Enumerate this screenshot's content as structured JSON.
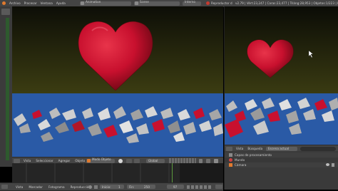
{
  "header": {
    "menu": [
      "Archivo",
      "Procesar",
      "Ventana",
      "Ayuda"
    ],
    "screen_layout": "Animation",
    "scene": "Scene",
    "engine": "Interno",
    "status_left": "Reproductor d",
    "status_stats": "v2.79 | Vért:23,247 | Caras:23,477 | Triáng:28,953 | Objetos:1/223 | Lám"
  },
  "viewport_toolbar": {
    "items": [
      "Vista",
      "Seleccionar",
      "Agregar",
      "Objeto"
    ],
    "mode": "Modo Objeto",
    "orientation": "Global"
  },
  "timeline": {
    "items": [
      "Vista",
      "Marcador",
      "Fotograma",
      "Reproducción"
    ],
    "start_label": "Inicio:",
    "start_value": "1",
    "end_label": "Fin:",
    "end_value": "250",
    "current_frame": "97"
  },
  "outliner": {
    "tabs": [
      "Vista",
      "Búsqueda"
    ],
    "scene_selector": "Escena actual",
    "rows": [
      "Capas de procesamiento",
      "Mundo",
      "Cámara"
    ]
  },
  "colors": {
    "ui_bg": "#444444",
    "heart_red": "#c8102e",
    "floor_blue": "#2a5aa6",
    "sky_top": "#0d0e07",
    "sky_bottom": "#3c3d12"
  }
}
